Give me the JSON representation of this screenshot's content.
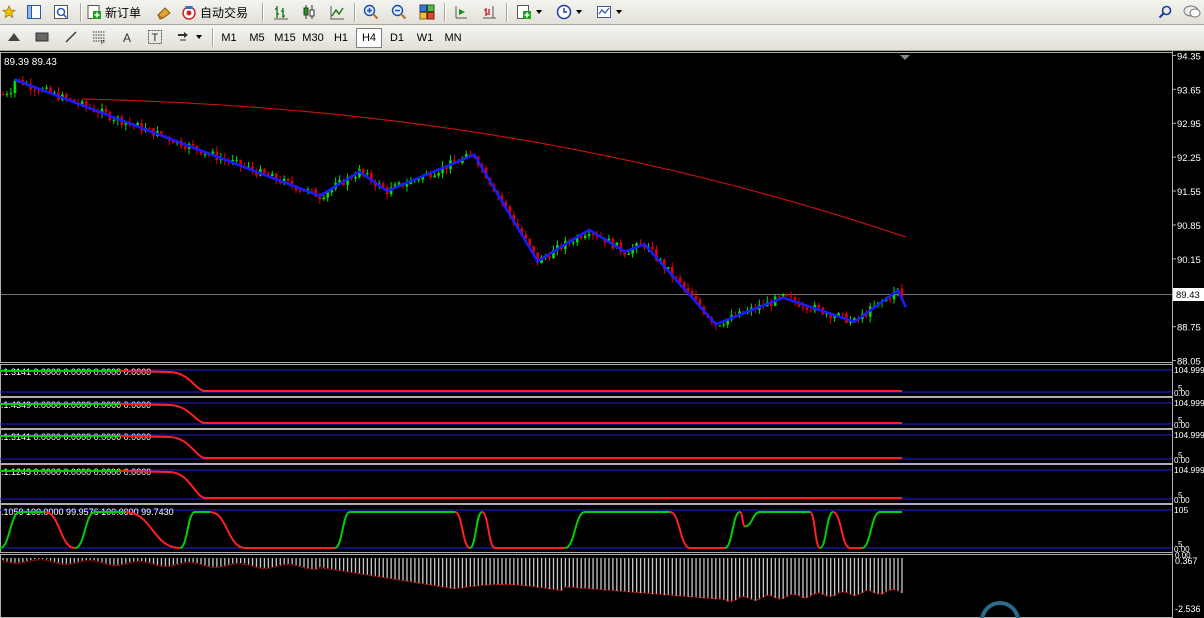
{
  "toolbar": {
    "new_order_label": "新订单",
    "auto_trade_label": "自动交易"
  },
  "timeframes": [
    "M1",
    "M5",
    "M15",
    "M30",
    "H1",
    "H4",
    "D1",
    "W1",
    "MN"
  ],
  "active_timeframe": "H4",
  "main_chart": {
    "ohlc_label": "89.39 89.43",
    "current_price": "89.43",
    "price_ticks": [
      "94.35",
      "93.65",
      "92.95",
      "92.25",
      "91.55",
      "90.85",
      "90.15",
      "88.75",
      "88.05"
    ],
    "price_range": [
      88.0,
      94.4
    ],
    "colors": {
      "bull": "#00e000",
      "bear": "#e00000",
      "zigzag": "#1a1aff",
      "ma": "#d01010"
    }
  },
  "indicators": [
    {
      "label": ".1.3141 0.0000 0.0000 0.0000 0.0000",
      "ticks": [
        "104.999",
        "5",
        "0.00"
      ]
    },
    {
      "label": ".1.4349 0.0000 0.0000 0.0000 0.0000",
      "ticks": [
        "104.999",
        "5",
        "0.00"
      ]
    },
    {
      "label": ".1.3141 0.0000 0.0000 0.0000 0.0000",
      "ticks": [
        "104.999",
        "5",
        "0.00"
      ]
    },
    {
      "label": ".1.1243 0.0000 0.0000 0.0000 0.0000",
      "ticks": [
        "104.999",
        "5",
        "0.00"
      ]
    },
    {
      "label": ".1059 100.0000 99.9576 100.0000 99.7430",
      "ticks": [
        "105",
        "5",
        "0.00"
      ]
    }
  ],
  "histogram_ticks": [
    "0.367",
    "0.00",
    "-2.536"
  ]
}
